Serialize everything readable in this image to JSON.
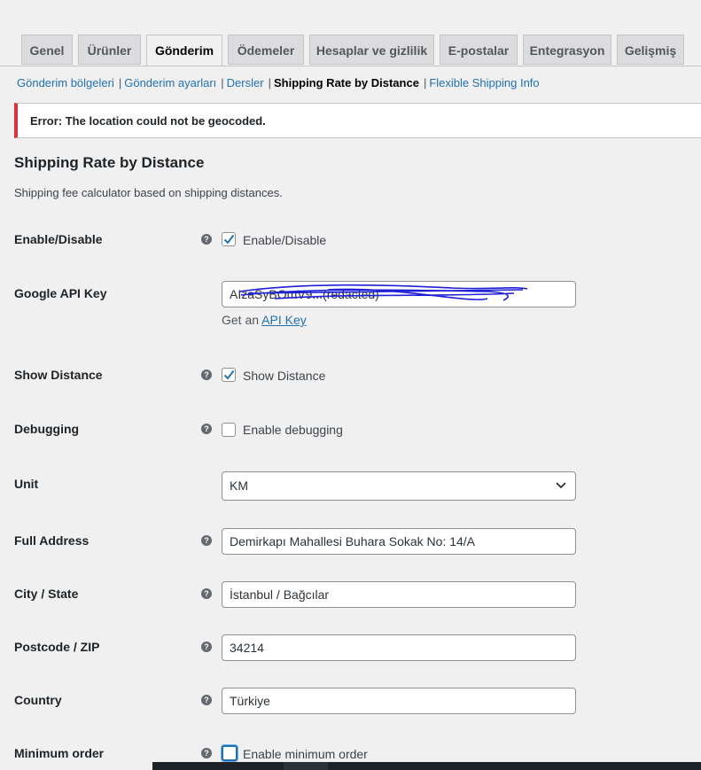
{
  "tabs": [
    {
      "label": "Genel",
      "active": false
    },
    {
      "label": "Ürünler",
      "active": false
    },
    {
      "label": "Gönderim",
      "active": true
    },
    {
      "label": "Ödemeler",
      "active": false
    },
    {
      "label": "Hesaplar ve gizlilik",
      "active": false
    },
    {
      "label": "E-postalar",
      "active": false
    },
    {
      "label": "Entegrasyon",
      "active": false
    },
    {
      "label": "Gelişmiş",
      "active": false
    }
  ],
  "subnav": [
    {
      "label": "Gönderim bölgeleri",
      "current": false
    },
    {
      "label": "Gönderim ayarları",
      "current": false
    },
    {
      "label": "Dersler",
      "current": false
    },
    {
      "label": "Shipping Rate by Distance",
      "current": true
    },
    {
      "label": "Flexible Shipping Info",
      "current": false
    }
  ],
  "subnav_separator": "|",
  "notice": {
    "text": "Error: The location could not be geocoded.",
    "color": "#d63638"
  },
  "section": {
    "title": "Shipping Rate by Distance",
    "description": "Shipping fee calculator based on shipping distances."
  },
  "help_glyph": "?",
  "fields": {
    "enable": {
      "label": "Enable/Disable",
      "checkbox_label": "Enable/Disable",
      "checked": true
    },
    "api_key": {
      "label": "Google API Key",
      "value": "AIzaSyBOmV9...(redacted)",
      "hint_prefix": "Get an ",
      "hint_link": "API Key"
    },
    "show_distance": {
      "label": "Show Distance",
      "checkbox_label": "Show Distance",
      "checked": true
    },
    "debugging": {
      "label": "Debugging",
      "checkbox_label": "Enable debugging",
      "checked": false
    },
    "unit": {
      "label": "Unit",
      "value": "KM"
    },
    "full_address": {
      "label": "Full Address",
      "value": "Demirkapı Mahallesi Buhara Sokak No: 14/A"
    },
    "city_state": {
      "label": "City / State",
      "value": "İstanbul / Bağcılar"
    },
    "postcode": {
      "label": "Postcode / ZIP",
      "value": "34214"
    },
    "country": {
      "label": "Country",
      "value": "Türkiye"
    },
    "minimum_order": {
      "label": "Minimum order",
      "checkbox_label": "Enable minimum order",
      "checked": false
    }
  },
  "colors": {
    "link": "#2271b1",
    "accent_check": "#2271b1",
    "background": "#f0f0f1"
  }
}
